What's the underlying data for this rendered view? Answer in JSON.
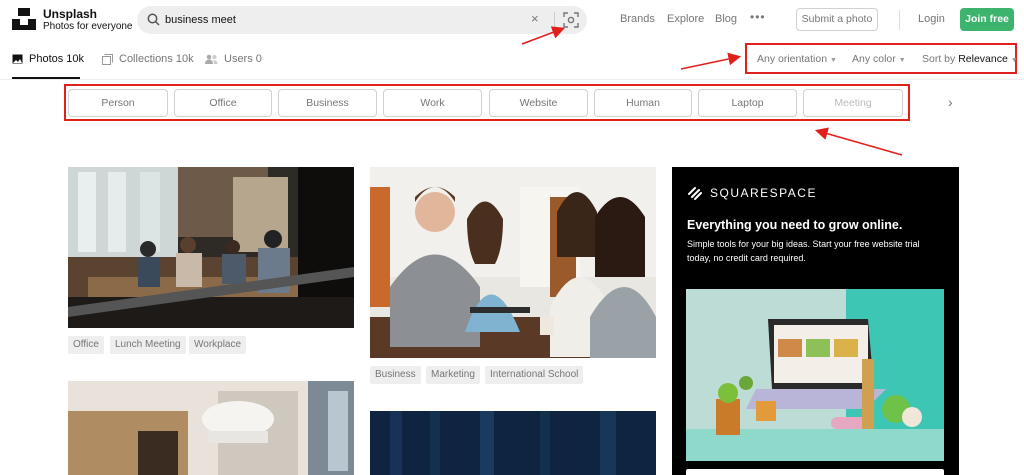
{
  "header": {
    "brand_name": "Unsplash",
    "brand_tagline": "Photos for everyone",
    "search_value": "business meet",
    "clear_glyph": "×",
    "nav": [
      "Brands",
      "Explore",
      "Blog"
    ],
    "more_glyph": "•••",
    "submit_label": "Submit a photo",
    "login_label": "Login",
    "join_label": "Join free",
    "accent_color": "#3cb46e"
  },
  "tabs": {
    "photos": "Photos 10k",
    "collections": "Collections 10k",
    "users": "Users 0"
  },
  "filters": {
    "orientation": "Any orientation",
    "color": "Any color",
    "sort_prefix": "Sort by",
    "sort_value": "Relevance"
  },
  "related": [
    "Person",
    "Office",
    "Business",
    "Work",
    "Website",
    "Human",
    "Laptop",
    "Meeting"
  ],
  "photos": {
    "first_tags": [
      "Office",
      "Lunch Meeting",
      "Workplace"
    ],
    "second_tags": [
      "Business",
      "Marketing",
      "International School"
    ]
  },
  "ad": {
    "brand": "SQUARESPACE",
    "headline": "Everything you need to grow online.",
    "body": "Simple tools for your big ideas. Start your free website trial today, no credit card required."
  },
  "annotation_color": "#e0201b"
}
